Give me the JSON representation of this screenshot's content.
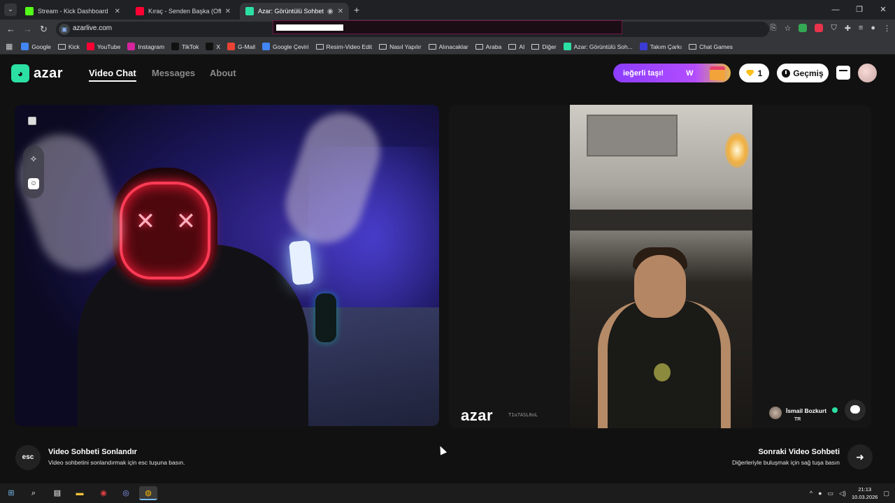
{
  "browser": {
    "tabs": [
      {
        "label": "Stream - Kick Dashboard",
        "color": "#53fc18"
      },
      {
        "label": "Kıraç - Senden Başka (Official V",
        "color": "#ff0033"
      },
      {
        "label": "Azar: Görüntülü Sohbet & V",
        "color": "#2be0a2"
      }
    ],
    "url": "azarlive.com",
    "bookmarks": [
      {
        "label": "Google",
        "type": "g"
      },
      {
        "label": "Kick",
        "type": "folder"
      },
      {
        "label": "YouTube",
        "type": "yt"
      },
      {
        "label": "Instagram",
        "type": "ig"
      },
      {
        "label": "TikTok",
        "type": "tt"
      },
      {
        "label": "X",
        "type": "x"
      },
      {
        "label": "G-Mail",
        "type": "gm"
      },
      {
        "label": "Google Çeviri",
        "type": "gt"
      },
      {
        "label": "Resim-Video Edit",
        "type": "folder"
      },
      {
        "label": "Nasıl Yapılır",
        "type": "folder"
      },
      {
        "label": "Alınacaklar",
        "type": "folder"
      },
      {
        "label": "Araba",
        "type": "folder"
      },
      {
        "label": "AI",
        "type": "folder"
      },
      {
        "label": "Diğer",
        "type": "folder"
      },
      {
        "label": "Azar: Görüntülü Soh...",
        "type": "azar"
      },
      {
        "label": "Takım Çarkı",
        "type": "wheel"
      },
      {
        "label": "Chat Games",
        "type": "folder"
      }
    ]
  },
  "header": {
    "logo_text": "azar",
    "nav": {
      "video_chat": "Video Chat",
      "messages": "Messages",
      "about": "About"
    },
    "promo_text": "ieğerli taşı!",
    "promo_letter": "W",
    "gem_count": "1",
    "history_label": "Geçmiş"
  },
  "video": {
    "watermark": "azar",
    "watermark_id": "T1u7ASL0oL",
    "peer_name": "İsmail Bozkurt",
    "peer_country": "TR"
  },
  "actions": {
    "end_key": "esc",
    "end_title": "Video Sohbeti Sonlandır",
    "end_subtitle": "Video sohbetini sonlandırmak için esc tuşuna basın.",
    "next_title": "Sonraki Video Sohbeti",
    "next_subtitle": "Diğerleriyle buluşmak için sağ tuşa basın"
  },
  "taskbar": {
    "time": "21:13",
    "date": "10.03.2026"
  },
  "colors": {
    "accent": "#2be0a2",
    "promo_purple": "#8b3dff",
    "gem_yellow": "#ffc01e"
  }
}
